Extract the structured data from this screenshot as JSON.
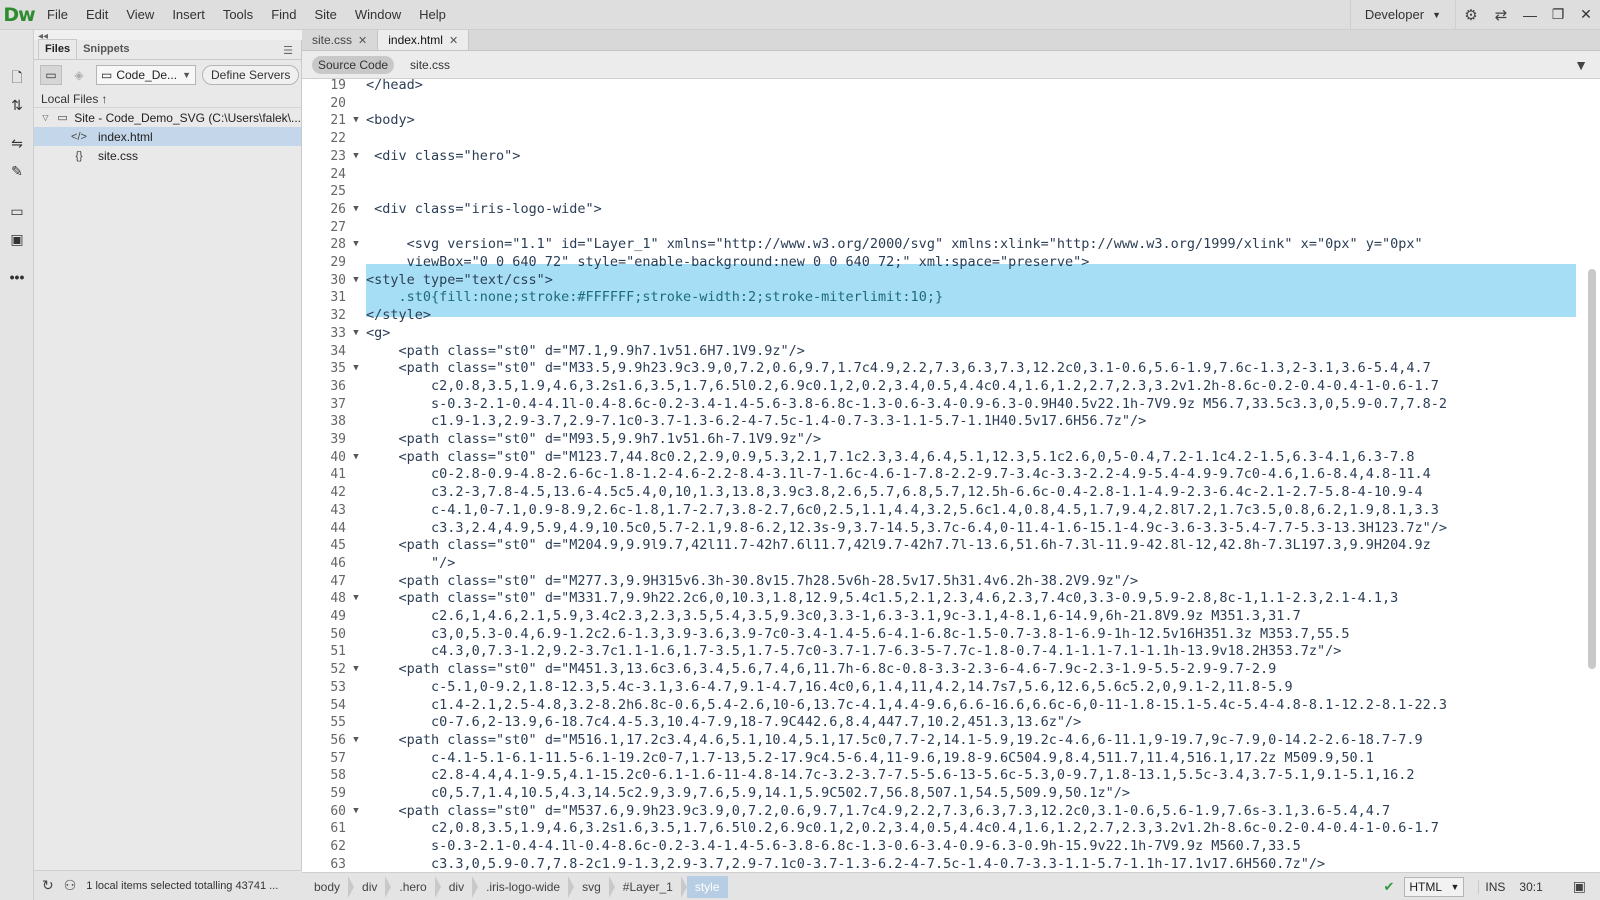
{
  "app": {
    "logo": "Dw"
  },
  "menu": [
    "File",
    "Edit",
    "View",
    "Insert",
    "Tools",
    "Find",
    "Site",
    "Window",
    "Help"
  ],
  "workspace": "Developer",
  "panel": {
    "tabs": [
      "Files",
      "Snippets"
    ],
    "site_name": "Code_De...",
    "define_servers": "Define Servers",
    "local_files": "Local Files",
    "tree": [
      {
        "label": "Site - Code_Demo_SVG (C:\\Users\\falek\\...",
        "icon": "folder-icon"
      },
      {
        "label": "index.html",
        "icon": "code-file-icon",
        "selected": true
      },
      {
        "label": "site.css",
        "icon": "css-file-icon"
      }
    ],
    "status": "1 local items selected totalling 43741 ..."
  },
  "doc_tabs": [
    {
      "label": "site.css",
      "active": false
    },
    {
      "label": "index.html",
      "active": true
    }
  ],
  "related_files": [
    "Source Code",
    "site.css"
  ],
  "code_lines": [
    {
      "n": "19",
      "fold": "",
      "ind": "",
      "text": "</head>"
    },
    {
      "n": "20",
      "fold": "",
      "ind": "",
      "text": ""
    },
    {
      "n": "21",
      "fold": "▼",
      "ind": "",
      "text": "<body>"
    },
    {
      "n": "22",
      "fold": "",
      "ind": "",
      "text": ""
    },
    {
      "n": "23",
      "fold": "▼",
      "ind": " ",
      "text": "<div class=\"hero\">"
    },
    {
      "n": "24",
      "fold": "",
      "ind": "",
      "text": ""
    },
    {
      "n": "25",
      "fold": "",
      "ind": "",
      "text": ""
    },
    {
      "n": "26",
      "fold": "▼",
      "ind": " ",
      "text": "<div class=\"iris-logo-wide\">"
    },
    {
      "n": "27",
      "fold": "",
      "ind": "",
      "text": ""
    },
    {
      "n": "28",
      "fold": "▼",
      "ind": "     ",
      "text": "<svg version=\"1.1\" id=\"Layer_1\" xmlns=\"http://www.w3.org/2000/svg\" xmlns:xlink=\"http://www.w3.org/1999/xlink\" x=\"0px\" y=\"0px\""
    },
    {
      "n": "29",
      "fold": "",
      "ind": "     ",
      "text": "viewBox=\"0 0 640 72\" style=\"enable-background:new 0 0 640 72;\" xml:space=\"preserve\">"
    },
    {
      "n": "30",
      "fold": "▼",
      "ind": "",
      "text": "<style type=\"text/css\">"
    },
    {
      "n": "31",
      "fold": "",
      "ind": "    ",
      "text": ".st0{fill:none;stroke:#FFFFFF;stroke-width:2;stroke-miterlimit:10;}"
    },
    {
      "n": "32",
      "fold": "",
      "ind": "",
      "text": "</style>"
    },
    {
      "n": "33",
      "fold": "▼",
      "ind": "",
      "text": "<g>"
    },
    {
      "n": "34",
      "fold": "",
      "ind": "    ",
      "text": "<path class=\"st0\" d=\"M7.1,9.9h7.1v51.6H7.1V9.9z\"/>"
    },
    {
      "n": "35",
      "fold": "▼",
      "ind": "    ",
      "text": "<path class=\"st0\" d=\"M33.5,9.9h23.9c3.9,0,7.2,0.6,9.7,1.7c4.9,2.2,7.3,6.3,7.3,12.2c0,3.1-0.6,5.6-1.9,7.6c-1.3,2-3.1,3.6-5.4,4.7"
    },
    {
      "n": "36",
      "fold": "",
      "ind": "        ",
      "text": "c2,0.8,3.5,1.9,4.6,3.2s1.6,3.5,1.7,6.5l0.2,6.9c0.1,2,0.2,3.4,0.5,4.4c0.4,1.6,1.2,2.7,2.3,3.2v1.2h-8.6c-0.2-0.4-0.4-1-0.6-1.7"
    },
    {
      "n": "37",
      "fold": "",
      "ind": "        ",
      "text": "s-0.3-2.1-0.4-4.1l-0.4-8.6c-0.2-3.4-1.4-5.6-3.8-6.8c-1.3-0.6-3.4-0.9-6.3-0.9H40.5v22.1h-7V9.9z M56.7,33.5c3.3,0,5.9-0.7,7.8-2"
    },
    {
      "n": "38",
      "fold": "",
      "ind": "        ",
      "text": "c1.9-1.3,2.9-3.7,2.9-7.1c0-3.7-1.3-6.2-4-7.5c-1.4-0.7-3.3-1.1-5.7-1.1H40.5v17.6H56.7z\"/>"
    },
    {
      "n": "39",
      "fold": "",
      "ind": "    ",
      "text": "<path class=\"st0\" d=\"M93.5,9.9h7.1v51.6h-7.1V9.9z\"/>"
    },
    {
      "n": "40",
      "fold": "▼",
      "ind": "    ",
      "text": "<path class=\"st0\" d=\"M123.7,44.8c0.2,2.9,0.9,5.3,2.1,7.1c2.3,3.4,6.4,5.1,12.3,5.1c2.6,0,5-0.4,7.2-1.1c4.2-1.5,6.3-4.1,6.3-7.8"
    },
    {
      "n": "41",
      "fold": "",
      "ind": "        ",
      "text": "c0-2.8-0.9-4.8-2.6-6c-1.8-1.2-4.6-2.2-8.4-3.1l-7-1.6c-4.6-1-7.8-2.2-9.7-3.4c-3.3-2.2-4.9-5.4-4.9-9.7c0-4.6,1.6-8.4,4.8-11.4"
    },
    {
      "n": "42",
      "fold": "",
      "ind": "        ",
      "text": "c3.2-3,7.8-4.5,13.6-4.5c5.4,0,10,1.3,13.8,3.9c3.8,2.6,5.7,6.8,5.7,12.5h-6.6c-0.4-2.8-1.1-4.9-2.3-6.4c-2.1-2.7-5.8-4-10.9-4"
    },
    {
      "n": "43",
      "fold": "",
      "ind": "        ",
      "text": "c-4.1,0-7.1,0.9-8.9,2.6c-1.8,1.7-2.7,3.8-2.7,6c0,2.5,1.1,4.4,3.2,5.6c1.4,0.8,4.5,1.7,9.4,2.8l7.2,1.7c3.5,0.8,6.2,1.9,8.1,3.3"
    },
    {
      "n": "44",
      "fold": "",
      "ind": "        ",
      "text": "c3.3,2.4,4.9,5.9,4.9,10.5c0,5.7-2.1,9.8-6.2,12.3s-9,3.7-14.5,3.7c-6.4,0-11.4-1.6-15.1-4.9c-3.6-3.3-5.4-7.7-5.3-13.3H123.7z\"/>"
    },
    {
      "n": "45",
      "fold": "",
      "ind": "    ",
      "text": "<path class=\"st0\" d=\"M204.9,9.9l9.7,42l11.7-42h7.6l11.7,42l9.7-42h7.7l-13.6,51.6h-7.3l-11.9-42.8l-12,42.8h-7.3L197.3,9.9H204.9z"
    },
    {
      "n": "46",
      "fold": "",
      "ind": "        ",
      "text": "\"/>"
    },
    {
      "n": "47",
      "fold": "",
      "ind": "    ",
      "text": "<path class=\"st0\" d=\"M277.3,9.9H315v6.3h-30.8v15.7h28.5v6h-28.5v17.5h31.4v6.2h-38.2V9.9z\"/>"
    },
    {
      "n": "48",
      "fold": "▼",
      "ind": "    ",
      "text": "<path class=\"st0\" d=\"M331.7,9.9h22.2c6,0,10.3,1.8,12.9,5.4c1.5,2.1,2.3,4.6,2.3,7.4c0,3.3-0.9,5.9-2.8,8c-1,1.1-2.3,2.1-4.1,3"
    },
    {
      "n": "49",
      "fold": "",
      "ind": "        ",
      "text": "c2.6,1,4.6,2.1,5.9,3.4c2.3,2.3,3.5,5.4,3.5,9.3c0,3.3-1,6.3-3.1,9c-3.1,4-8.1,6-14.9,6h-21.8V9.9z M351.3,31.7"
    },
    {
      "n": "50",
      "fold": "",
      "ind": "        ",
      "text": "c3,0,5.3-0.4,6.9-1.2c2.6-1.3,3.9-3.6,3.9-7c0-3.4-1.4-5.6-4.1-6.8c-1.5-0.7-3.8-1-6.9-1h-12.5v16H351.3z M353.7,55.5"
    },
    {
      "n": "51",
      "fold": "",
      "ind": "        ",
      "text": "c4.3,0,7.3-1.2,9.2-3.7c1.1-1.6,1.7-3.5,1.7-5.7c0-3.7-1.7-6.3-5-7.7c-1.8-0.7-4.1-1.1-7.1-1.1h-13.9v18.2H353.7z\"/>"
    },
    {
      "n": "52",
      "fold": "▼",
      "ind": "    ",
      "text": "<path class=\"st0\" d=\"M451.3,13.6c3.6,3.4,5.6,7.4,6,11.7h-6.8c-0.8-3.3-2.3-6-4.6-7.9c-2.3-1.9-5.5-2.9-9.7-2.9"
    },
    {
      "n": "53",
      "fold": "",
      "ind": "        ",
      "text": "c-5.1,0-9.2,1.8-12.3,5.4c-3.1,3.6-4.7,9.1-4.7,16.4c0,6,1.4,11,4.2,14.7s7,5.6,12.6,5.6c5.2,0,9.1-2,11.8-5.9"
    },
    {
      "n": "54",
      "fold": "",
      "ind": "        ",
      "text": "c1.4-2.1,2.5-4.8,3.2-8.2h6.8c-0.6,5.4-2.6,10-6,13.7c-4.1,4.4-9.6,6.6-16.6,6.6c-6,0-11-1.8-15.1-5.4c-5.4-4.8-8.1-12.2-8.1-22.3"
    },
    {
      "n": "55",
      "fold": "",
      "ind": "        ",
      "text": "c0-7.6,2-13.9,6-18.7c4.4-5.3,10.4-7.9,18-7.9C442.6,8.4,447.7,10.2,451.3,13.6z\"/>"
    },
    {
      "n": "56",
      "fold": "▼",
      "ind": "    ",
      "text": "<path class=\"st0\" d=\"M516.1,17.2c3.4,4.6,5.1,10.4,5.1,17.5c0,7.7-2,14.1-5.9,19.2c-4.6,6-11.1,9-19.7,9c-7.9,0-14.2-2.6-18.7-7.9"
    },
    {
      "n": "57",
      "fold": "",
      "ind": "        ",
      "text": "c-4.1-5.1-6.1-11.5-6.1-19.2c0-7,1.7-13,5.2-17.9c4.5-6.4,11-9.6,19.8-9.6C504.9,8.4,511.7,11.4,516.1,17.2z M509.9,50.1"
    },
    {
      "n": "58",
      "fold": "",
      "ind": "        ",
      "text": "c2.8-4.4,4.1-9.5,4.1-15.2c0-6.1-1.6-11-4.8-14.7c-3.2-3.7-7.5-5.6-13-5.6c-5.3,0-9.7,1.8-13.1,5.5c-3.4,3.7-5.1,9.1-5.1,16.2"
    },
    {
      "n": "59",
      "fold": "",
      "ind": "        ",
      "text": "c0,5.7,1.4,10.5,4.3,14.5c2.9,3.9,7.6,5.9,14.1,5.9C502.7,56.8,507.1,54.5,509.9,50.1z\"/>"
    },
    {
      "n": "60",
      "fold": "▼",
      "ind": "    ",
      "text": "<path class=\"st0\" d=\"M537.6,9.9h23.9c3.9,0,7.2,0.6,9.7,1.7c4.9,2.2,7.3,6.3,7.3,12.2c0,3.1-0.6,5.6-1.9,7.6s-3.1,3.6-5.4,4.7"
    },
    {
      "n": "61",
      "fold": "",
      "ind": "        ",
      "text": "c2,0.8,3.5,1.9,4.6,3.2s1.6,3.5,1.7,6.5l0.2,6.9c0.1,2,0.2,3.4,0.5,4.4c0.4,1.6,1.2,2.7,2.3,3.2v1.2h-8.6c-0.2-0.4-0.4-1-0.6-1.7"
    },
    {
      "n": "62",
      "fold": "",
      "ind": "        ",
      "text": "s-0.3-2.1-0.4-4.1l-0.4-8.6c-0.2-3.4-1.4-5.6-3.8-6.8c-1.3-0.6-3.4-0.9-6.3-0.9h-15.9v22.1h-7V9.9z M560.7,33.5"
    },
    {
      "n": "63",
      "fold": "",
      "ind": "        ",
      "text": "c3.3,0,5.9-0.7,7.8-2c1.9-1.3,2.9-3.7,2.9-7.1c0-3.7-1.3-6.2-4-7.5c-1.4-0.7-3.3-1.1-5.7-1.1h-17.1v17.6H560.7z\"/>"
    }
  ],
  "breadcrumbs": [
    "body",
    "div",
    ".hero",
    "div",
    ".iris-logo-wide",
    "svg",
    "#Layer_1",
    "style"
  ],
  "status": {
    "language": "HTML",
    "mode": "INS",
    "position": "30:1"
  }
}
